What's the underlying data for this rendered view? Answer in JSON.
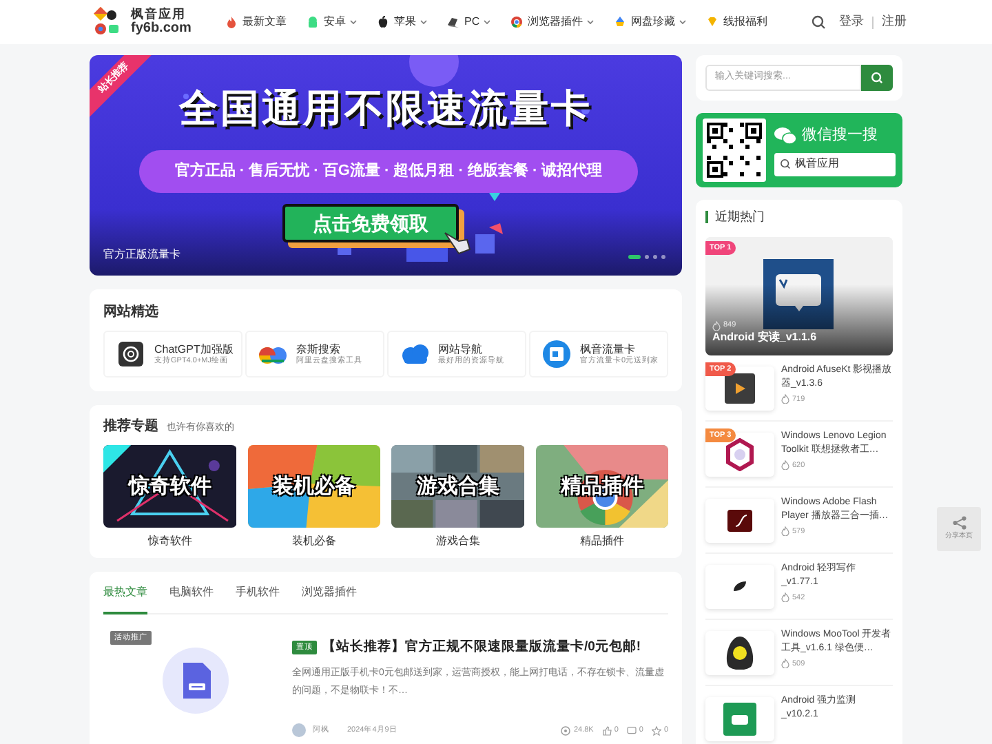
{
  "header": {
    "logo": {
      "line1": "枫音应用",
      "line2": "fy6b.com"
    },
    "nav": [
      {
        "label": "最新文章",
        "dropdown": false
      },
      {
        "label": "安卓",
        "dropdown": true
      },
      {
        "label": "苹果",
        "dropdown": true
      },
      {
        "label": "PC",
        "dropdown": true
      },
      {
        "label": "浏览器插件",
        "dropdown": true
      },
      {
        "label": "网盘珍藏",
        "dropdown": true
      },
      {
        "label": "线报福利",
        "dropdown": false
      }
    ],
    "login": "登录",
    "register": "注册"
  },
  "banner": {
    "badge": "站长推荐",
    "headline": "全国通用不限速流量卡",
    "tagline": "官方正品 · 售后无忧 · 百G流量 · 超低月租 · 绝版套餐 · 诚招代理",
    "cta": "点击免费领取",
    "caption": "官方正版流量卡",
    "slides": [
      {
        "selected": true
      },
      {
        "selected": false
      },
      {
        "selected": false
      },
      {
        "selected": false
      }
    ]
  },
  "sites": {
    "title": "网站精选",
    "items": [
      {
        "name": "ChatGPT加强版",
        "desc": "支持GPT4.0+MJ绘画"
      },
      {
        "name": "奈斯搜索",
        "desc": "阿里云盘搜索工具"
      },
      {
        "name": "网站导航",
        "desc": "最好用的资源导航"
      },
      {
        "name": "枫音流量卡",
        "desc": "官方流量卡0元送到家"
      }
    ]
  },
  "topics": {
    "title": "推荐专题",
    "subtitle": "也许有你喜欢的",
    "items": [
      {
        "overlay": "惊奇软件",
        "caption": "惊奇软件"
      },
      {
        "overlay": "装机必备",
        "caption": "装机必备"
      },
      {
        "overlay": "游戏合集",
        "caption": "游戏合集"
      },
      {
        "overlay": "精品插件",
        "caption": "精品插件"
      }
    ]
  },
  "articles": {
    "tabs": [
      {
        "label": "最热文章",
        "selected": true
      },
      {
        "label": "电脑软件",
        "selected": false
      },
      {
        "label": "手机软件",
        "selected": false
      },
      {
        "label": "浏览器插件",
        "selected": false
      }
    ],
    "post": {
      "ad_label": "活动推广",
      "tag": "置顶",
      "title": "【站长推荐】官方正规不限速限量版流量卡/0元包邮!",
      "excerpt": "全网通用正版手机卡0元包邮送到家，运营商授权，能上网打电话，不存在锁卡、流量虚的问题，不是物联卡！不…",
      "author": "阿枫",
      "date": "2024年4月9日",
      "views": "24.8K",
      "likes": "0",
      "comments": "0",
      "stars": "0"
    }
  },
  "sidebar": {
    "search": {
      "placeholder": "输入关键词搜索..."
    },
    "wechat": {
      "title": "微信搜一搜",
      "query": "枫音应用"
    },
    "hot": {
      "title": "近期热门",
      "featured": {
        "rank": "TOP 1",
        "count": "849",
        "title": "Android 安读_v1.1.6"
      },
      "items": [
        {
          "rank": "TOP 2",
          "title": "Android AfuseKt 影视播放器_v1.3.6",
          "count": "719"
        },
        {
          "rank": "TOP 3",
          "title": "Windows Lenovo Legion Toolkit 联想拯救者工…",
          "count": "620"
        },
        {
          "title": "Windows Adobe Flash Player 播放器三合一插…",
          "count": "579"
        },
        {
          "title": "Android 轻羽写作 _v1.77.1",
          "count": "542"
        },
        {
          "title": "Windows MooTool 开发者工具_v1.6.1 绿色便…",
          "count": "509"
        },
        {
          "title": "Android 强力监测 _v10.2.1"
        }
      ]
    }
  },
  "share": "分享本页"
}
